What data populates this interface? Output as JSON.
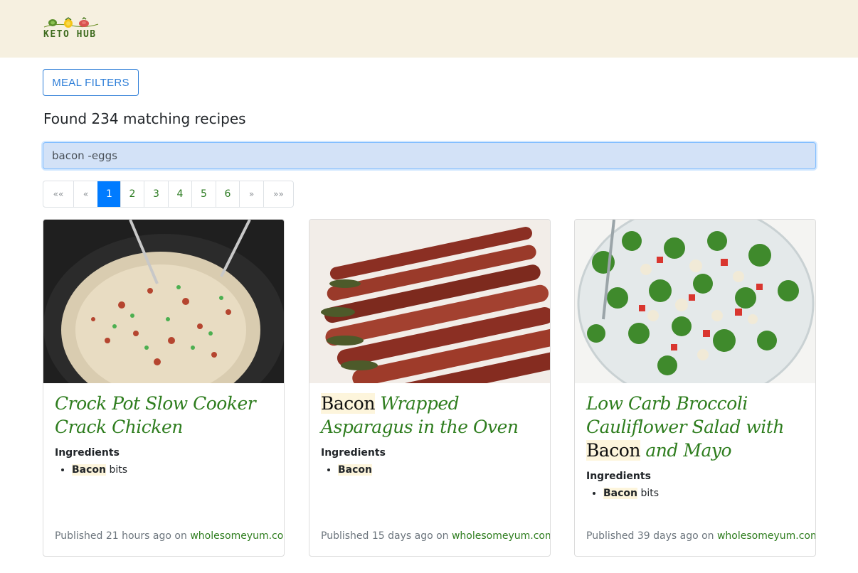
{
  "app": {
    "logo_text": "KETO HUB"
  },
  "filters": {
    "button_label": "MEAL FILTERS"
  },
  "results": {
    "summary": "Found 234 matching recipes"
  },
  "search": {
    "value": "bacon -eggs"
  },
  "pagination": {
    "first": "«« ",
    "prev": "«",
    "pages": [
      "1",
      "2",
      "3",
      "4",
      "5",
      "6"
    ],
    "next": "»",
    "last": "»»",
    "active_page": "1"
  },
  "colors": {
    "navbar_bg": "#f6f0e0",
    "accent_green": "#2e7d1e",
    "primary_blue": "#007bff",
    "highlight": "#fdf5dc"
  },
  "cards": [
    {
      "title_pre": "",
      "title_hl": "",
      "title_post": "Crock Pot Slow Cooker Crack Chicken",
      "ingredients_heading": "Ingredients",
      "ingredients": [
        {
          "hl": "Bacon",
          "rest": " bits"
        }
      ],
      "published_prefix": "Published 21 hours ago on ",
      "source": "wholesomeyum.com",
      "image": "slow-cooker-chicken-photo"
    },
    {
      "title_pre": "",
      "title_hl": "Bacon",
      "title_post": " Wrapped Asparagus in the Oven",
      "ingredients_heading": "Ingredients",
      "ingredients": [
        {
          "hl": "Bacon",
          "rest": ""
        }
      ],
      "published_prefix": "Published 15 days ago on ",
      "source": "wholesomeyum.com",
      "image": "bacon-asparagus-photo"
    },
    {
      "title_pre": "Low Carb Broccoli Cauliflower Salad with ",
      "title_hl": "Bacon",
      "title_post": " and Mayo",
      "ingredients_heading": "Ingredients",
      "ingredients": [
        {
          "hl": "Bacon",
          "rest": " bits"
        }
      ],
      "published_prefix": "Published 39 days ago on ",
      "source": "wholesomeyum.com",
      "image": "broccoli-salad-photo"
    }
  ]
}
